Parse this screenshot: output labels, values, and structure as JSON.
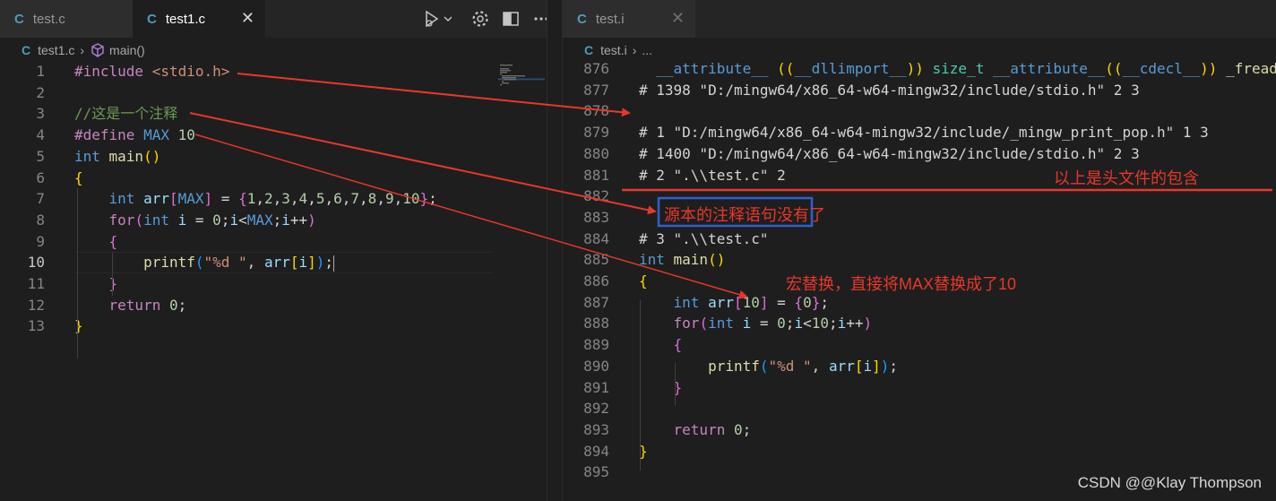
{
  "left_editor": {
    "tabs": [
      {
        "icon": "C",
        "label": "test.c",
        "active": false
      },
      {
        "icon": "C",
        "label": "test1.c",
        "active": true,
        "close": "✕"
      }
    ],
    "breadcrumb": {
      "file": "test1.c",
      "symbol": "main()"
    },
    "lines": [
      {
        "n": "1",
        "tokens": [
          [
            "pp",
            "#include "
          ],
          [
            "str",
            "<stdio.h>"
          ]
        ]
      },
      {
        "n": "2",
        "tokens": []
      },
      {
        "n": "3",
        "tokens": [
          [
            "cmt",
            "//这是一个注释"
          ]
        ]
      },
      {
        "n": "4",
        "tokens": [
          [
            "pp",
            "#define "
          ],
          [
            "mac",
            "MAX "
          ],
          [
            "num",
            "10"
          ]
        ]
      },
      {
        "n": "5",
        "tokens": [
          [
            "kw",
            "int "
          ],
          [
            "fn",
            "main"
          ],
          [
            "br1",
            "()"
          ]
        ]
      },
      {
        "n": "6",
        "tokens": [
          [
            "br1",
            "{"
          ]
        ]
      },
      {
        "n": "7",
        "tokens": [
          [
            "plain",
            "    "
          ],
          [
            "kw",
            "int "
          ],
          [
            "var",
            "arr"
          ],
          [
            "br2",
            "["
          ],
          [
            "mac",
            "MAX"
          ],
          [
            "br2",
            "]"
          ],
          [
            "plain",
            " = "
          ],
          [
            "br2",
            "{"
          ],
          [
            "num",
            "1"
          ],
          [
            "plain",
            ","
          ],
          [
            "num",
            "2"
          ],
          [
            "plain",
            ","
          ],
          [
            "num",
            "3"
          ],
          [
            "plain",
            ","
          ],
          [
            "num",
            "4"
          ],
          [
            "plain",
            ","
          ],
          [
            "num",
            "5"
          ],
          [
            "plain",
            ","
          ],
          [
            "num",
            "6"
          ],
          [
            "plain",
            ","
          ],
          [
            "num",
            "7"
          ],
          [
            "plain",
            ","
          ],
          [
            "num",
            "8"
          ],
          [
            "plain",
            ","
          ],
          [
            "num",
            "9"
          ],
          [
            "plain",
            ","
          ],
          [
            "num",
            "10"
          ],
          [
            "br2",
            "}"
          ],
          [
            "plain",
            ";"
          ]
        ]
      },
      {
        "n": "8",
        "tokens": [
          [
            "plain",
            "    "
          ],
          [
            "ctl",
            "for"
          ],
          [
            "br2",
            "("
          ],
          [
            "kw",
            "int "
          ],
          [
            "var",
            "i"
          ],
          [
            "plain",
            " = "
          ],
          [
            "num",
            "0"
          ],
          [
            "plain",
            ";"
          ],
          [
            "var",
            "i"
          ],
          [
            "plain",
            "<"
          ],
          [
            "mac",
            "MAX"
          ],
          [
            "plain",
            ";"
          ],
          [
            "var",
            "i"
          ],
          [
            "plain",
            "++"
          ],
          [
            "br2",
            ")"
          ]
        ]
      },
      {
        "n": "9",
        "tokens": [
          [
            "plain",
            "    "
          ],
          [
            "br2",
            "{"
          ]
        ]
      },
      {
        "n": "10",
        "current": true,
        "tokens": [
          [
            "plain",
            "        "
          ],
          [
            "fn",
            "printf"
          ],
          [
            "br3",
            "("
          ],
          [
            "str",
            "\"%d \""
          ],
          [
            "plain",
            ", "
          ],
          [
            "var",
            "arr"
          ],
          [
            "br1",
            "["
          ],
          [
            "var",
            "i"
          ],
          [
            "br1",
            "]"
          ],
          [
            "br3",
            ")"
          ],
          [
            "plain",
            ";"
          ]
        ]
      },
      {
        "n": "11",
        "tokens": [
          [
            "plain",
            "    "
          ],
          [
            "br2",
            "}"
          ]
        ]
      },
      {
        "n": "12",
        "tokens": [
          [
            "plain",
            "    "
          ],
          [
            "ctl",
            "return "
          ],
          [
            "num",
            "0"
          ],
          [
            "plain",
            ";"
          ]
        ]
      },
      {
        "n": "13",
        "tokens": [
          [
            "br1",
            "}"
          ]
        ]
      }
    ]
  },
  "right_editor": {
    "tabs": [
      {
        "icon": "C",
        "label": "test.i",
        "active": false,
        "close": "✕"
      }
    ],
    "breadcrumb": {
      "file": "test.i",
      "rest": "..."
    },
    "lines": [
      {
        "n": "876",
        "tokens": [
          [
            "plain",
            "  "
          ],
          [
            "kw",
            "__attribute__ "
          ],
          [
            "br1",
            "(("
          ],
          [
            "kw",
            "__dllimport__"
          ],
          [
            "br1",
            "))"
          ],
          [
            "plain",
            " "
          ],
          [
            "typ",
            "size_t "
          ],
          [
            "kw",
            "__attribute__"
          ],
          [
            "br1",
            "(("
          ],
          [
            "kw",
            "__cdecl__"
          ],
          [
            "br1",
            "))"
          ],
          [
            "plain",
            " "
          ],
          [
            "fn",
            "_fread"
          ]
        ]
      },
      {
        "n": "877",
        "tokens": [
          [
            "plain",
            "# 1398 \"D:/mingw64/x86_64-w64-mingw32/include/stdio.h\" 2 3"
          ]
        ]
      },
      {
        "n": "878",
        "tokens": []
      },
      {
        "n": "879",
        "tokens": [
          [
            "plain",
            "# 1 \"D:/mingw64/x86_64-w64-mingw32/include/_mingw_print_pop.h\" 1 3"
          ]
        ]
      },
      {
        "n": "880",
        "tokens": [
          [
            "plain",
            "# 1400 \"D:/mingw64/x86_64-w64-mingw32/include/stdio.h\" 2 3"
          ]
        ]
      },
      {
        "n": "881",
        "tokens": [
          [
            "plain",
            "# 2 \".\\\\test.c\" 2"
          ]
        ]
      },
      {
        "n": "882",
        "tokens": []
      },
      {
        "n": "883",
        "tokens": []
      },
      {
        "n": "884",
        "tokens": [
          [
            "plain",
            "# 3 \".\\\\test.c\""
          ]
        ]
      },
      {
        "n": "885",
        "tokens": [
          [
            "kw",
            "int "
          ],
          [
            "fn",
            "main"
          ],
          [
            "br1",
            "()"
          ]
        ]
      },
      {
        "n": "886",
        "tokens": [
          [
            "br1",
            "{"
          ]
        ]
      },
      {
        "n": "887",
        "tokens": [
          [
            "plain",
            "    "
          ],
          [
            "kw",
            "int "
          ],
          [
            "var",
            "arr"
          ],
          [
            "br2",
            "["
          ],
          [
            "num",
            "10"
          ],
          [
            "br2",
            "]"
          ],
          [
            "plain",
            " = "
          ],
          [
            "br2",
            "{"
          ],
          [
            "num",
            "0"
          ],
          [
            "br2",
            "}"
          ],
          [
            "plain",
            ";"
          ]
        ]
      },
      {
        "n": "888",
        "tokens": [
          [
            "plain",
            "    "
          ],
          [
            "ctl",
            "for"
          ],
          [
            "br2",
            "("
          ],
          [
            "kw",
            "int "
          ],
          [
            "var",
            "i"
          ],
          [
            "plain",
            " = "
          ],
          [
            "num",
            "0"
          ],
          [
            "plain",
            ";"
          ],
          [
            "var",
            "i"
          ],
          [
            "plain",
            "<"
          ],
          [
            "num",
            "10"
          ],
          [
            "plain",
            ";"
          ],
          [
            "var",
            "i"
          ],
          [
            "plain",
            "++"
          ],
          [
            "br2",
            ")"
          ]
        ]
      },
      {
        "n": "889",
        "tokens": [
          [
            "plain",
            "    "
          ],
          [
            "br2",
            "{"
          ]
        ]
      },
      {
        "n": "890",
        "tokens": [
          [
            "plain",
            "        "
          ],
          [
            "fn",
            "printf"
          ],
          [
            "br3",
            "("
          ],
          [
            "str",
            "\"%d \""
          ],
          [
            "plain",
            ", "
          ],
          [
            "var",
            "arr"
          ],
          [
            "br1",
            "["
          ],
          [
            "var",
            "i"
          ],
          [
            "br1",
            "]"
          ],
          [
            "br3",
            ")"
          ],
          [
            "plain",
            ";"
          ]
        ]
      },
      {
        "n": "891",
        "tokens": [
          [
            "plain",
            "    "
          ],
          [
            "br2",
            "}"
          ]
        ]
      },
      {
        "n": "892",
        "tokens": []
      },
      {
        "n": "893",
        "tokens": [
          [
            "plain",
            "    "
          ],
          [
            "ctl",
            "return "
          ],
          [
            "num",
            "0"
          ],
          [
            "plain",
            ";"
          ]
        ]
      },
      {
        "n": "894",
        "tokens": [
          [
            "br1",
            "}"
          ]
        ]
      },
      {
        "n": "895",
        "tokens": []
      }
    ]
  },
  "annotations": {
    "header_include": "以上是头文件的包含",
    "comment_gone": "源本的注释语句没有了",
    "macro_replace": "宏替换，直接将MAX替换成了10"
  },
  "colors": {
    "annotation_red": "#e8372b",
    "box_blue": "#2f5fd0"
  },
  "watermark": "CSDN @@Klay Thompson"
}
